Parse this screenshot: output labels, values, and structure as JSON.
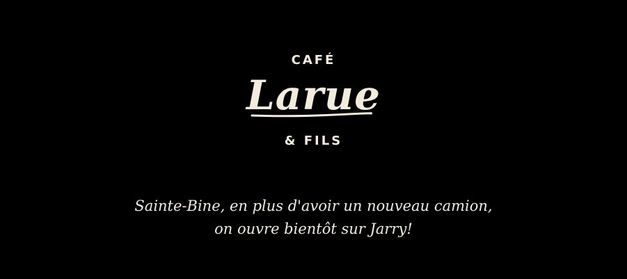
{
  "logo": {
    "top_text": "CAFÉ",
    "name": "Larue",
    "bottom_text": "& FILS"
  },
  "message": {
    "line1": "Sainte-Bine, en plus d'avoir un nouveau camion,",
    "line2": "on ouvre bientôt sur Jarry!"
  },
  "colors": {
    "background": "#000000",
    "text": "#f3ecdc"
  }
}
